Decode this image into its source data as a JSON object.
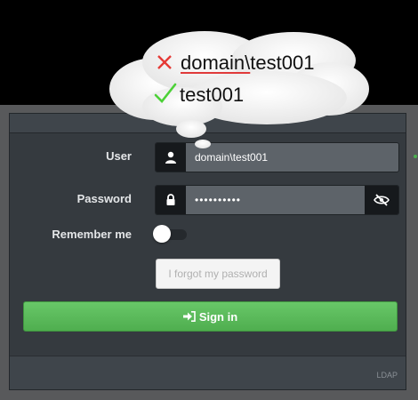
{
  "annotation": {
    "wrong_prefix": "domain\\",
    "wrong_suffix": "test001",
    "correct": "test001",
    "wrong_icon": "cross-icon",
    "correct_icon": "check-icon",
    "wrong_color": "#e53935",
    "correct_color": "#4cd137"
  },
  "form": {
    "user_label": "User",
    "user_value": "domain\\test001",
    "user_icon": "user-icon",
    "password_label": "Password",
    "password_value": "••••••••••",
    "password_icon": "lock-icon",
    "reveal_icon": "eye-slash-icon",
    "remember_label": "Remember me",
    "forgot_label": "I forgot my password",
    "signin_label": "Sign in",
    "signin_icon": "sign-in-icon"
  },
  "footer": {
    "text": "LDAP"
  },
  "colors": {
    "accent": "#5cb85c"
  }
}
